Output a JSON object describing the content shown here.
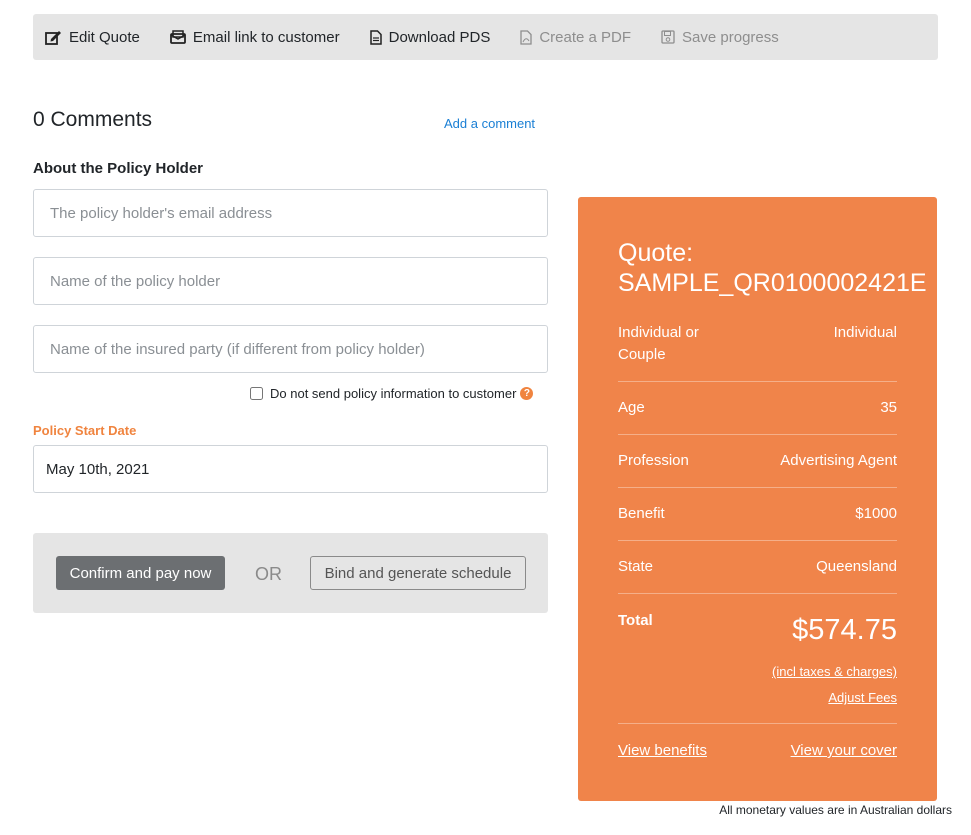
{
  "toolbar": {
    "edit_quote": "Edit Quote",
    "email_link": "Email link to customer",
    "download_pds": "Download PDS",
    "create_pdf": "Create a PDF",
    "save_progress": "Save progress"
  },
  "comments": {
    "title": "0 Comments",
    "add_link": "Add a comment"
  },
  "policy_holder": {
    "section_title": "About the Policy Holder",
    "email_placeholder": "The policy holder's email address",
    "name_placeholder": "Name of the policy holder",
    "insured_placeholder": "Name of the insured party (if different from policy holder)",
    "no_send_label": "Do not send policy information to customer",
    "help_glyph": "?"
  },
  "start_date": {
    "label": "Policy Start Date",
    "value": "May 10th, 2021"
  },
  "actions": {
    "confirm_label": "Confirm and pay now",
    "or_label": "OR",
    "bind_label": "Bind and generate schedule"
  },
  "quote": {
    "title_line1": "Quote:",
    "title_line2": "SAMPLE_QR0100002421E",
    "rows": [
      {
        "label": "Individual or Couple",
        "value": "Individual"
      },
      {
        "label": "Age",
        "value": "35"
      },
      {
        "label": "Profession",
        "value": "Advertising Agent"
      },
      {
        "label": "Benefit",
        "value": "$1000"
      },
      {
        "label": "State",
        "value": "Queensland"
      }
    ],
    "total_label": "Total",
    "total_value": "$574.75",
    "incl_taxes": "(incl taxes & charges)",
    "adjust_fees": "Adjust Fees",
    "view_benefits": "View benefits",
    "view_cover": "View your cover"
  },
  "footnote": "All monetary values are in Australian dollars",
  "colors": {
    "accent_orange": "#f0844a",
    "link_blue": "#1a7fd4",
    "toolbar_bg": "#e5e5e5"
  }
}
